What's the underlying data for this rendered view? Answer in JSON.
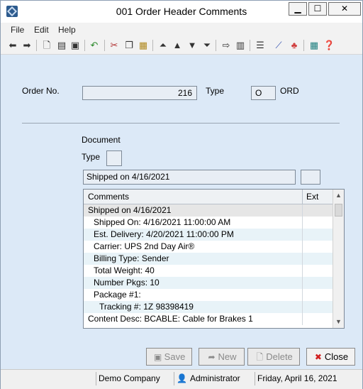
{
  "window": {
    "title": "001 Order Header Comments",
    "minimize_glyph": "▁",
    "maximize_glyph": "☐",
    "close_glyph": "✕"
  },
  "menu": [
    "File",
    "Edit",
    "Help"
  ],
  "toolbar_icons": [
    "back-icon",
    "forward-icon",
    "new-document-icon",
    "open-icon",
    "save-icon",
    "undo-icon",
    "cut-icon",
    "copy-icon",
    "paste-icon",
    "first-record-icon",
    "previous-record-icon",
    "next-record-icon",
    "last-record-icon",
    "export-icon",
    "print-icon",
    "notes-icon",
    "chart-icon",
    "shapes-icon",
    "calculator-icon",
    "help-icon"
  ],
  "order": {
    "order_no_label": "Order No.",
    "order_no_value": "216",
    "type_label": "Type",
    "type_value": "O",
    "type_desc": "ORD"
  },
  "document": {
    "document_label": "Document",
    "type_label": "Type",
    "type_value": "",
    "subject_value": "Shipped on 4/16/2021",
    "extra_value": ""
  },
  "comments_grid": {
    "columns": [
      "Comments",
      "Ext"
    ],
    "rows": [
      {
        "text": "Shipped on 4/16/2021",
        "indent": 0,
        "shade": "header"
      },
      {
        "text": "Shipped On: 4/16/2021 11:00:00 AM",
        "indent": 1,
        "shade": "white"
      },
      {
        "text": "Est. Delivery: 4/20/2021 11:00:00 PM",
        "indent": 1,
        "shade": "alt"
      },
      {
        "text": "Carrier: UPS 2nd Day Air®",
        "indent": 1,
        "shade": "white"
      },
      {
        "text": "Billing Type: Sender",
        "indent": 1,
        "shade": "alt"
      },
      {
        "text": "Total Weight: 40",
        "indent": 1,
        "shade": "white"
      },
      {
        "text": "Number Pkgs: 10",
        "indent": 1,
        "shade": "alt"
      },
      {
        "text": "Package #1:",
        "indent": 1,
        "shade": "white"
      },
      {
        "text": "Tracking #: 1Z           98398419",
        "indent": 2,
        "shade": "alt"
      },
      {
        "text": "Content Desc: BCABLE: Cable for Brakes 1",
        "indent": 0,
        "shade": "white"
      }
    ]
  },
  "buttons": {
    "save": "Save",
    "new": "New",
    "delete": "Delete",
    "close": "Close"
  },
  "status": {
    "company": "Demo Company",
    "user": "Administrator",
    "date": "Friday, April 16, 2021"
  },
  "colors": {
    "panel_bg": "#dce9f7",
    "alt_row": "#e8f3f8",
    "header_row": "#e6e6e6",
    "close_icon": "#d11f1f"
  }
}
